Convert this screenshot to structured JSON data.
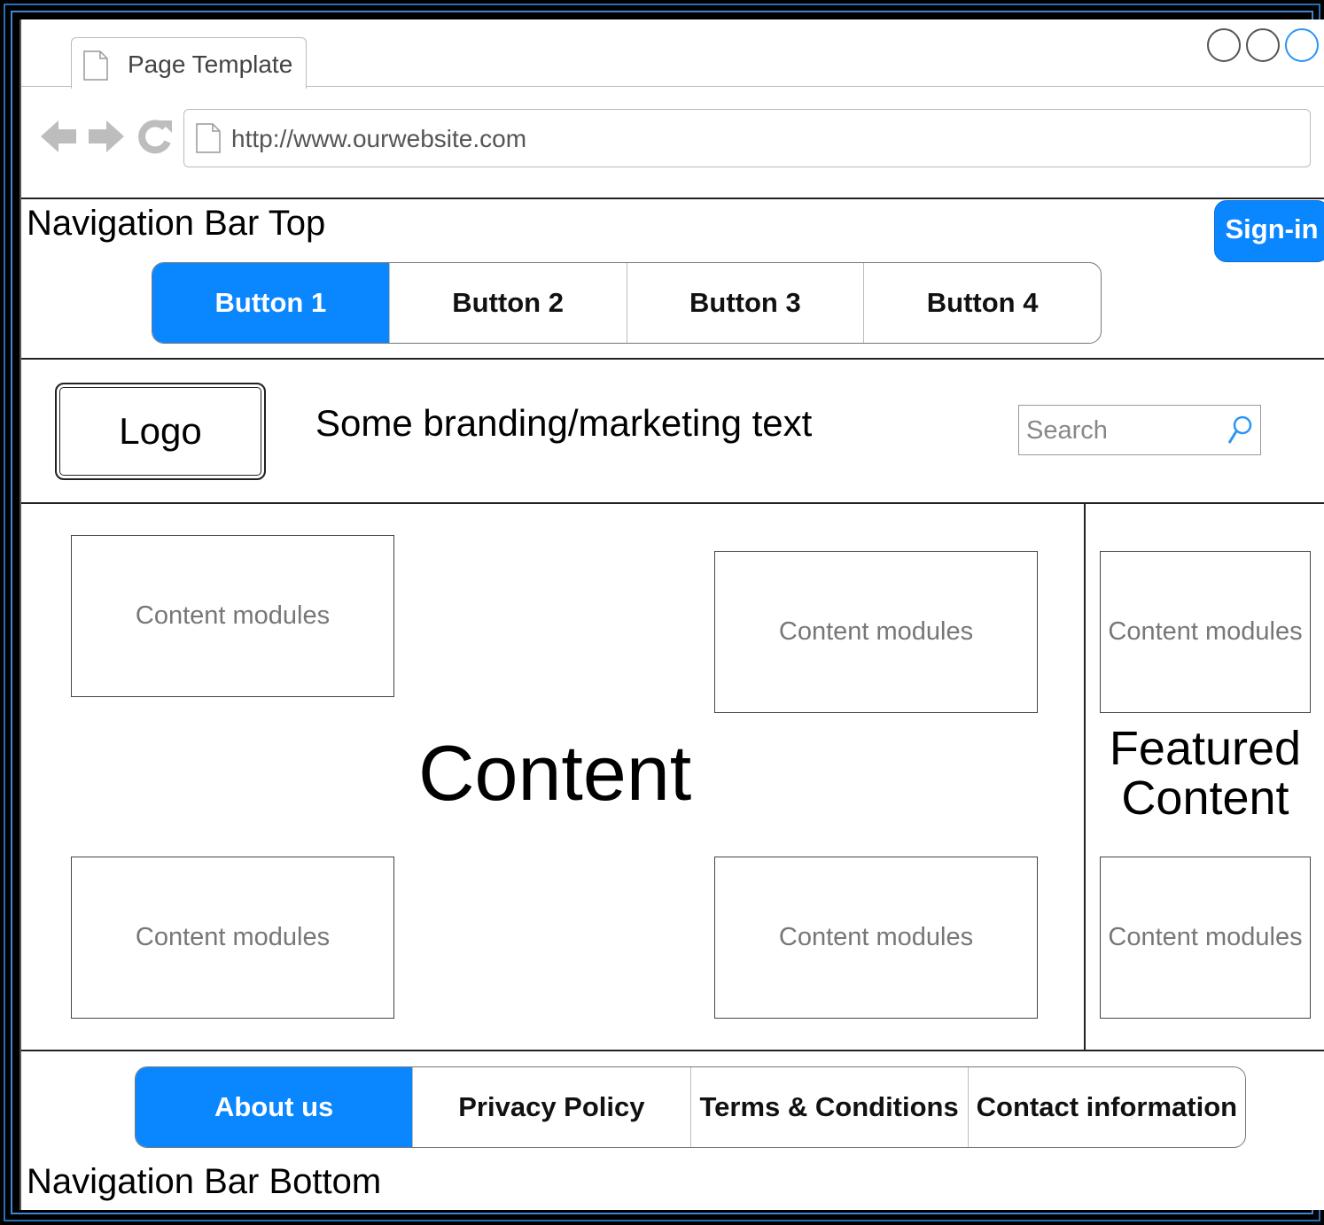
{
  "browser": {
    "tab_title": "Page Template",
    "url": "http://www.ourwebsite.com",
    "icons": [
      "back-arrow-icon",
      "forward-arrow-icon",
      "reload-icon",
      "page-icon"
    ]
  },
  "nav_top": {
    "label": "Navigation Bar Top",
    "signin_label": "Sign-in",
    "buttons": [
      "Button 1",
      "Button 2",
      "Button 3",
      "Button 4"
    ],
    "active_index": 0
  },
  "branding": {
    "logo": "Logo",
    "text": "Some branding/marketing text",
    "search_placeholder": "Search"
  },
  "content": {
    "title": "Content",
    "module_label": "Content modules",
    "modules": [
      "Content modules",
      "Content modules",
      "Content modules",
      "Content modules"
    ]
  },
  "featured": {
    "title": "Featured Content",
    "modules": [
      "Content modules",
      "Content modules"
    ]
  },
  "nav_bottom": {
    "label": "Navigation Bar Bottom",
    "buttons": [
      "About us",
      "Privacy Policy",
      "Terms & Conditions",
      "Contact information"
    ],
    "active_index": 0
  },
  "colors": {
    "accent": "#0a87ff",
    "frame": "#2b6fb3"
  }
}
